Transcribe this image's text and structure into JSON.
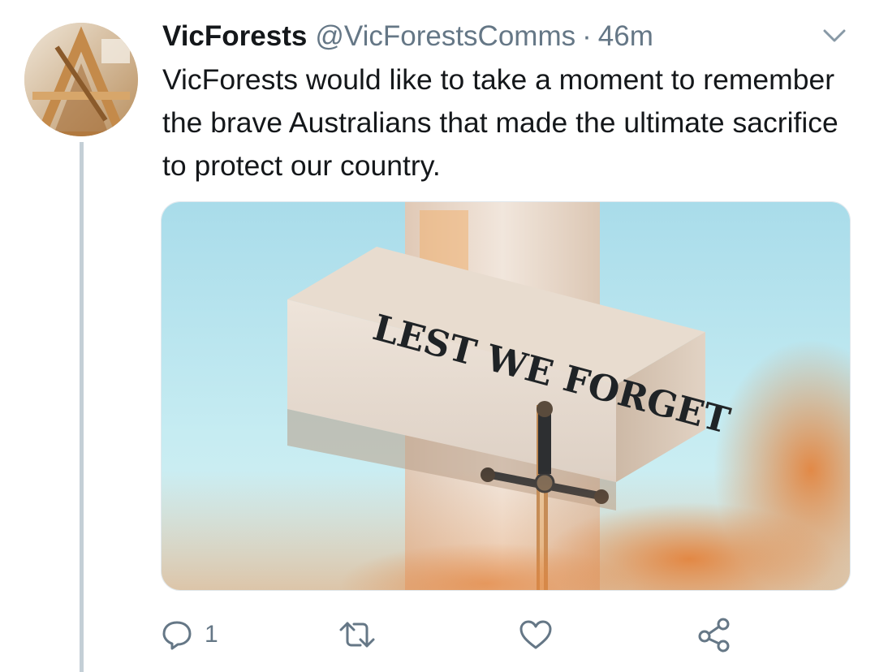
{
  "tweet": {
    "display_name": "VicForests",
    "handle": "@VicForestsComms",
    "separator": "·",
    "time": "46m",
    "text": "VicForests would like to take a moment to remember the brave Australians that made the ultimate sacrifice to protect our country.",
    "media": {
      "inscription": "LEST WE FORGET"
    },
    "actions": {
      "reply_count": "1",
      "reply_icon": "reply-icon",
      "retweet_icon": "retweet-icon",
      "like_icon": "heart-icon",
      "share_icon": "share-icon"
    }
  },
  "colors": {
    "text_primary": "#14171a",
    "text_secondary": "#657786",
    "thread_line": "#c4cfd6"
  }
}
